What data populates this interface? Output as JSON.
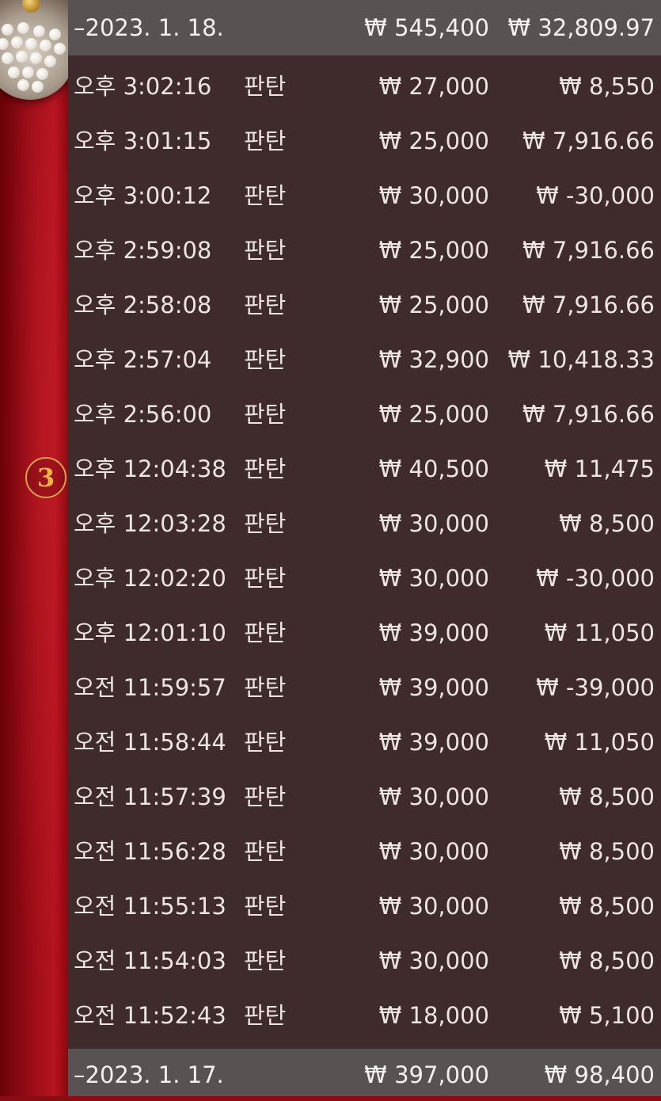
{
  "badge": "3",
  "groups": [
    {
      "date": "–2023. 1. 18.",
      "total_amount": "₩ 545,400",
      "total_result": "₩ 32,809.97"
    },
    {
      "date": "–2023. 1. 17.",
      "total_amount": "₩ 397,000",
      "total_result": "₩ 98,400"
    }
  ],
  "rows": [
    {
      "time": "오후 3:02:16",
      "type": "판탄",
      "amount": "₩ 27,000",
      "result": "₩ 8,550"
    },
    {
      "time": "오후 3:01:15",
      "type": "판탄",
      "amount": "₩ 25,000",
      "result": "₩ 7,916.66"
    },
    {
      "time": "오후 3:00:12",
      "type": "판탄",
      "amount": "₩ 30,000",
      "result": "₩ -30,000"
    },
    {
      "time": "오후 2:59:08",
      "type": "판탄",
      "amount": "₩ 25,000",
      "result": "₩ 7,916.66"
    },
    {
      "time": "오후 2:58:08",
      "type": "판탄",
      "amount": "₩ 25,000",
      "result": "₩ 7,916.66"
    },
    {
      "time": "오후 2:57:04",
      "type": "판탄",
      "amount": "₩ 32,900",
      "result": "₩ 10,418.33"
    },
    {
      "time": "오후 2:56:00",
      "type": "판탄",
      "amount": "₩ 25,000",
      "result": "₩ 7,916.66"
    },
    {
      "time": "오후 12:04:38",
      "type": "판탄",
      "amount": "₩ 40,500",
      "result": "₩ 11,475"
    },
    {
      "time": "오후 12:03:28",
      "type": "판탄",
      "amount": "₩ 30,000",
      "result": "₩ 8,500"
    },
    {
      "time": "오후 12:02:20",
      "type": "판탄",
      "amount": "₩ 30,000",
      "result": "₩ -30,000"
    },
    {
      "time": "오후 12:01:10",
      "type": "판탄",
      "amount": "₩ 39,000",
      "result": "₩ 11,050"
    },
    {
      "time": "오전 11:59:57",
      "type": "판탄",
      "amount": "₩ 39,000",
      "result": "₩ -39,000"
    },
    {
      "time": "오전 11:58:44",
      "type": "판탄",
      "amount": "₩ 39,000",
      "result": "₩ 11,050"
    },
    {
      "time": "오전 11:57:39",
      "type": "판탄",
      "amount": "₩ 30,000",
      "result": "₩ 8,500"
    },
    {
      "time": "오전 11:56:28",
      "type": "판탄",
      "amount": "₩ 30,000",
      "result": "₩ 8,500"
    },
    {
      "time": "오전 11:55:13",
      "type": "판탄",
      "amount": "₩ 30,000",
      "result": "₩ 8,500"
    },
    {
      "time": "오전 11:54:03",
      "type": "판탄",
      "amount": "₩ 30,000",
      "result": "₩ 8,500"
    },
    {
      "time": "오전 11:52:43",
      "type": "판탄",
      "amount": "₩ 18,000",
      "result": "₩ 5,100"
    }
  ]
}
